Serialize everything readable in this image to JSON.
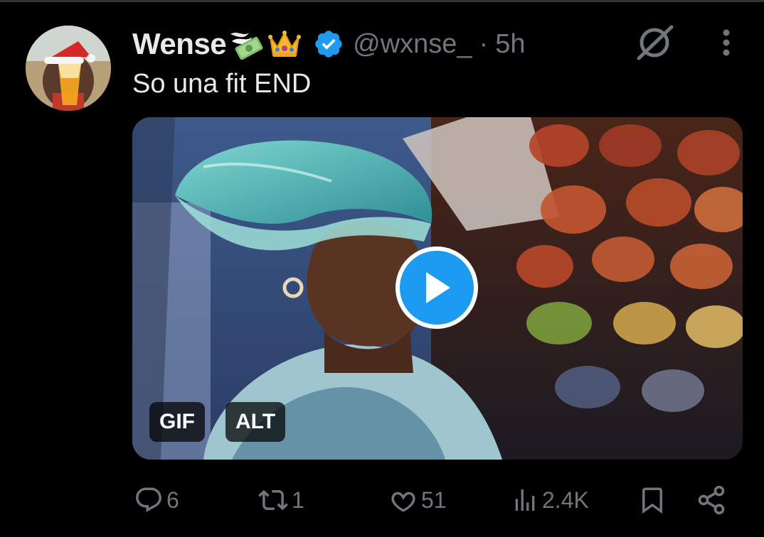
{
  "tweet": {
    "author_name": "Wense",
    "handle": "@wxnse_",
    "separator": "·",
    "time": "5h",
    "text": "So una fit END",
    "media": {
      "gif_badge": "GIF",
      "alt_badge": "ALT"
    }
  },
  "actions": {
    "replies": "6",
    "reposts": "1",
    "likes": "51",
    "views": "2.4K"
  },
  "icons": {
    "name_emoji_1": "money-with-wings",
    "name_emoji_2": "crown",
    "verified": "verified-badge-icon",
    "grok": "grok-icon",
    "more": "more-vertical-icon",
    "reply": "reply-icon",
    "repost": "repost-icon",
    "like": "heart-icon",
    "views": "views-icon",
    "bookmark": "bookmark-icon",
    "share": "share-icon"
  },
  "colors": {
    "background": "#000000",
    "primary_text": "#e7e9ea",
    "secondary_text": "#71767b",
    "accent": "#1d9bf0"
  }
}
